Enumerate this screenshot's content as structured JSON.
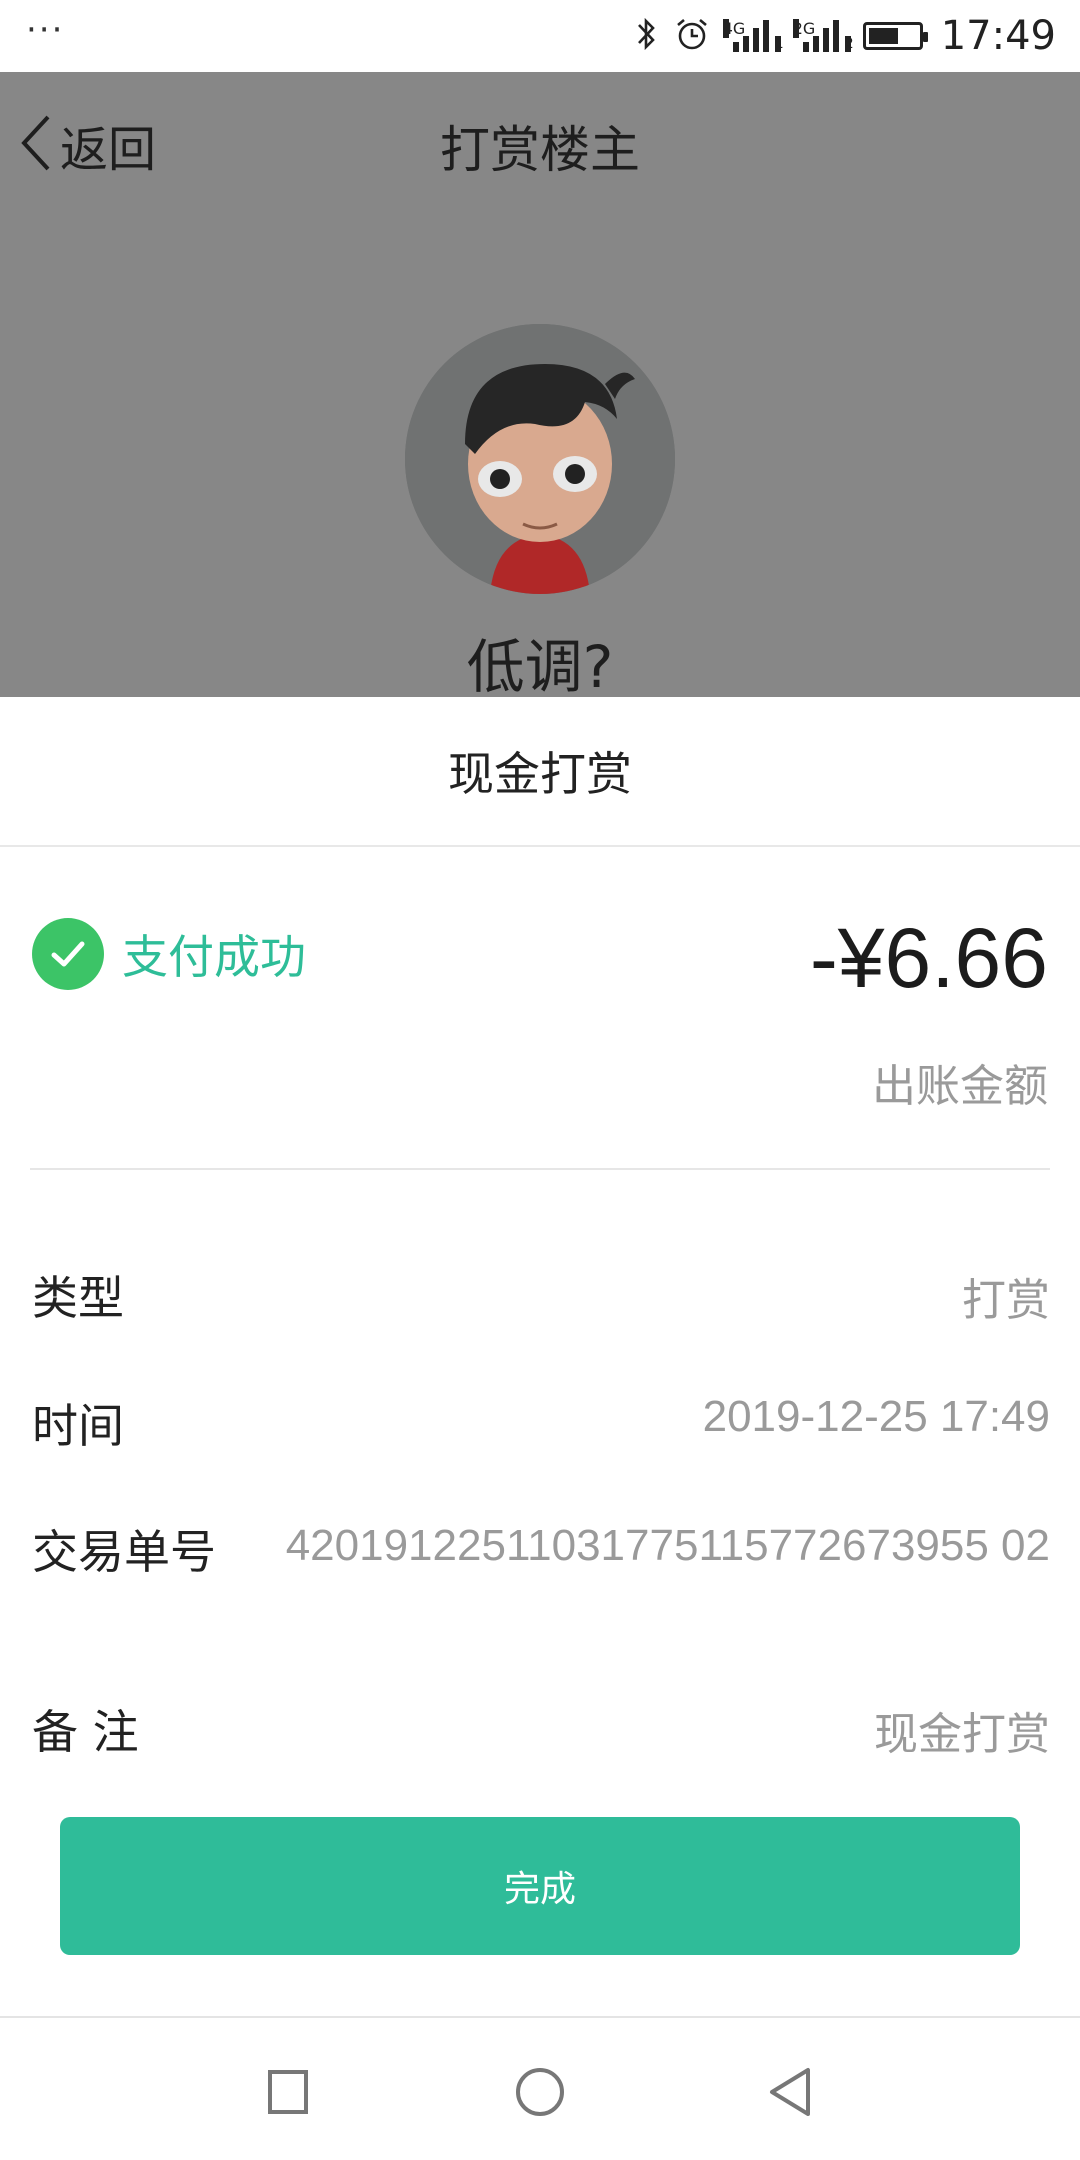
{
  "status_bar": {
    "dots": "···",
    "network_1": "4G",
    "sim_1": "1",
    "network_2": "2G",
    "sim_2": "2",
    "battery_level": 0.6,
    "time": "17:49"
  },
  "header": {
    "back_label": "返回",
    "title": "打赏楼主",
    "username": "低调?"
  },
  "section_title": "现金打赏",
  "payment": {
    "status_text": "支付成功",
    "amount": "-¥6.66",
    "amount_label": "出账金额"
  },
  "details": {
    "type_label": "类型",
    "type_value": "打赏",
    "time_label": "时间",
    "time_value": "2019-12-25 17:49",
    "txn_label": "交易单号",
    "txn_value": "42019122511031775115772673955 02",
    "note_label": "备  注",
    "note_value": "现金打赏"
  },
  "done_button": "完成",
  "colors": {
    "accent": "#2fbc99",
    "success": "#3cc467",
    "dim_overlay": "#878787"
  }
}
